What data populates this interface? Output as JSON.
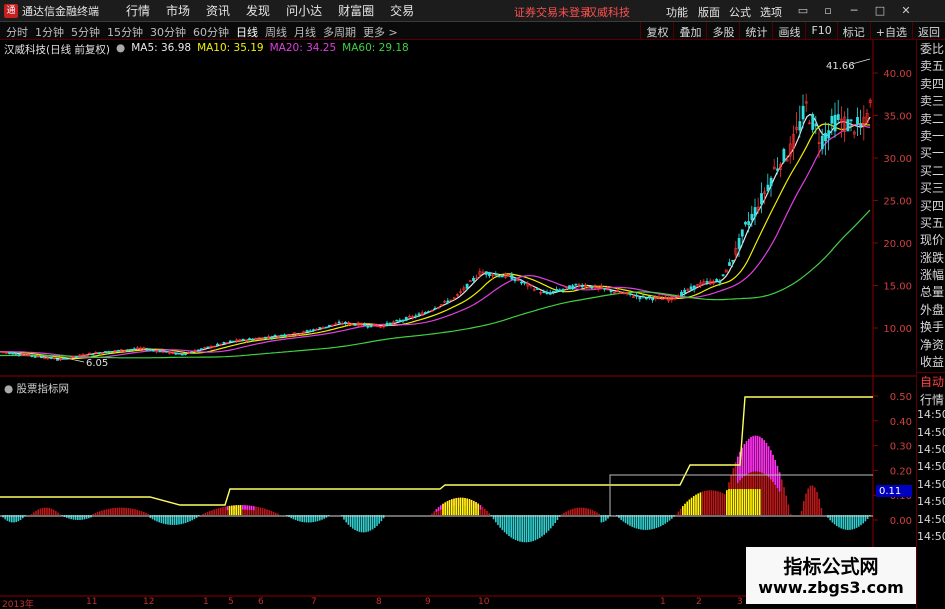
{
  "titlebar": {
    "app_title": "通达信金融终端",
    "menu": [
      "行情",
      "市场",
      "资讯",
      "发现",
      "问小达",
      "财富圈",
      "交易"
    ],
    "login_status": "证券交易未登录",
    "stock_title": "汉威科技",
    "right_menu": [
      "功能",
      "版面",
      "公式",
      "选项"
    ]
  },
  "toolbar": {
    "periods": [
      "分时",
      "1分钟",
      "5分钟",
      "15分钟",
      "30分钟",
      "60分钟",
      "日线",
      "周线",
      "月线",
      "多周期",
      "更多 >"
    ],
    "active_period": "日线",
    "right_tools": [
      "复权",
      "叠加",
      "多股",
      "统计",
      "画线",
      "F10",
      "标记",
      "+自选",
      "返回"
    ]
  },
  "info": {
    "stock_name": "汉威科技(日线 前复权)",
    "ma5": "MA5: 36.98",
    "ma10": "MA10: 35.19",
    "ma20": "MA20: 34.25",
    "ma60": "MA60: 29.18"
  },
  "main_chart": {
    "price_axis": [
      "40.00",
      "35.00",
      "30.00",
      "25.00",
      "20.00",
      "15.00",
      "10.00"
    ],
    "high_label": "41.66",
    "low_label": "6.05",
    "colors": {
      "up": "#ff3030",
      "down": "#30e0e0",
      "ma5": "#e8e8e8",
      "ma10": "#f0f000",
      "ma20": "#e040e0",
      "ma60": "#40d040"
    }
  },
  "indicator": {
    "title": "股票指标网",
    "axis": [
      "0.50",
      "0.40",
      "0.30",
      "0.20",
      "0.10",
      "0.00"
    ],
    "current_value": "0.11",
    "colors": {
      "red": "#c01818",
      "magenta": "#ff30ff",
      "yellow": "#ffff00",
      "cyan": "#30d0d0",
      "yellow_line": "#ffff60",
      "white_line": "#d8d8d8"
    }
  },
  "date_axis": [
    "2013年",
    "11",
    "12",
    "1",
    "5",
    "6",
    "7",
    "8",
    "9",
    "10",
    "1",
    "2",
    "3"
  ],
  "sidepanel": {
    "labels": [
      "委比",
      "卖五",
      "卖四",
      "卖三",
      "卖二",
      "卖一",
      "买一",
      "买二",
      "买三",
      "买四",
      "买五",
      "现价",
      "涨跌",
      "涨幅",
      "总量",
      "外盘",
      "换手",
      "净资",
      "收益"
    ],
    "lower": [
      "自动",
      "行情"
    ],
    "times": [
      "14:50",
      "14:50",
      "14:50",
      "14:50",
      "14:50",
      "14:50",
      "14:50",
      "14:50"
    ]
  },
  "watermark": {
    "title": "指标公式网",
    "url": "www.zbgs3.com"
  }
}
